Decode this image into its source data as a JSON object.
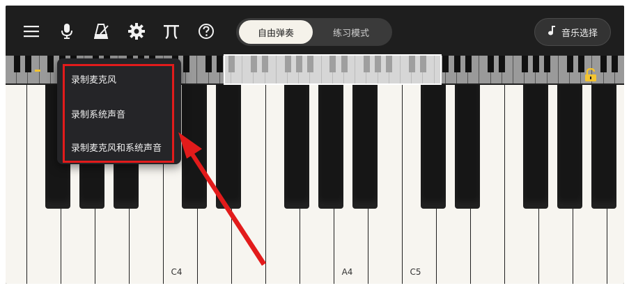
{
  "toolbar": {
    "icons": [
      "menu-icon",
      "microphone-icon",
      "metronome-icon",
      "gear-icon",
      "tuning-fork-icon",
      "help-icon"
    ],
    "mode_tabs": [
      {
        "label": "自由弹奏",
        "selected": true
      },
      {
        "label": "练习模式",
        "selected": false
      }
    ],
    "music_select_label": "音乐选择",
    "music_select_icon": "music-note-icon"
  },
  "record_menu": {
    "items": [
      "录制麦克风",
      "录制系统声音",
      "录制麦克风和系统声音"
    ]
  },
  "keyboard": {
    "note_labels": {
      "c4": "C4",
      "a4": "A4",
      "c5": "C5"
    },
    "lock_icon": "unlocked-lock-icon"
  },
  "colors": {
    "background": "#1e1e1e",
    "highlight": "#e21b1b",
    "accent_yellow": "#f4c430"
  }
}
